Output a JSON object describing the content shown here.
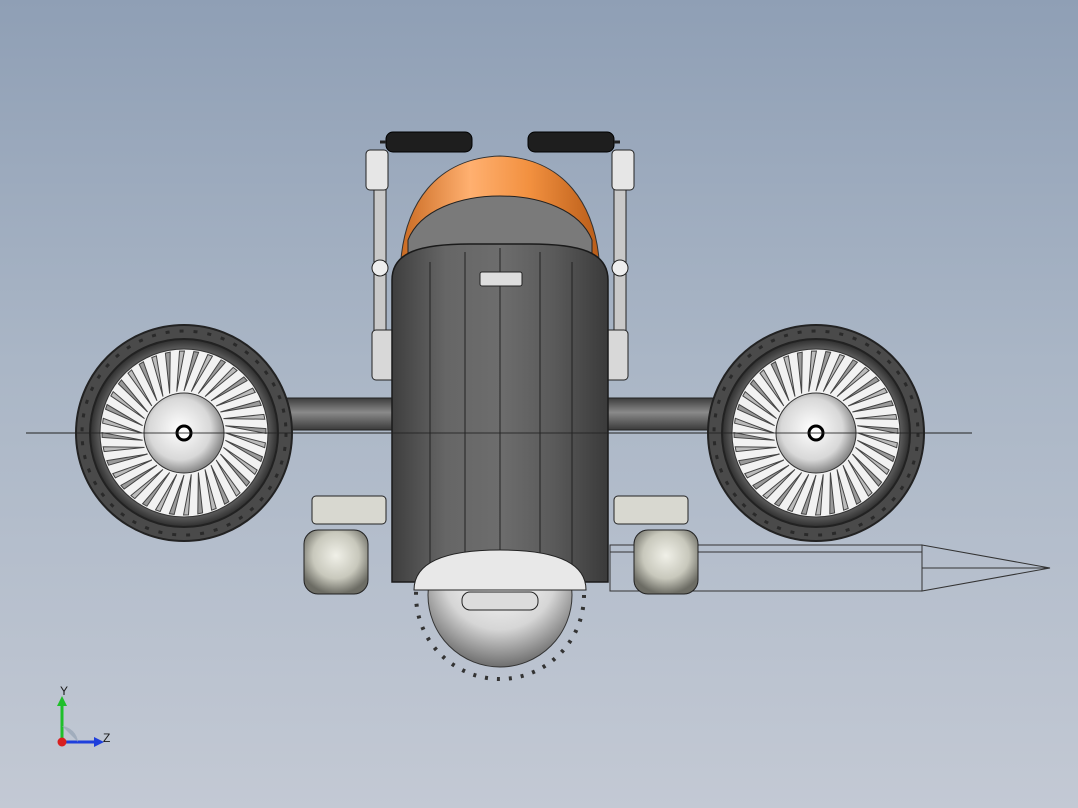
{
  "view": {
    "background_top": "#8f9fb5",
    "background_bottom": "#c3c9d4",
    "body_color": "#5c5c5c",
    "canopy_color": "#f08a3c",
    "handle_color": "#1e1e1e"
  },
  "triad": {
    "y_label": "Y",
    "z_label": "Z",
    "y_color": "#1fbf2a",
    "z_color": "#1f3fdc",
    "x_color": "#d82020"
  }
}
